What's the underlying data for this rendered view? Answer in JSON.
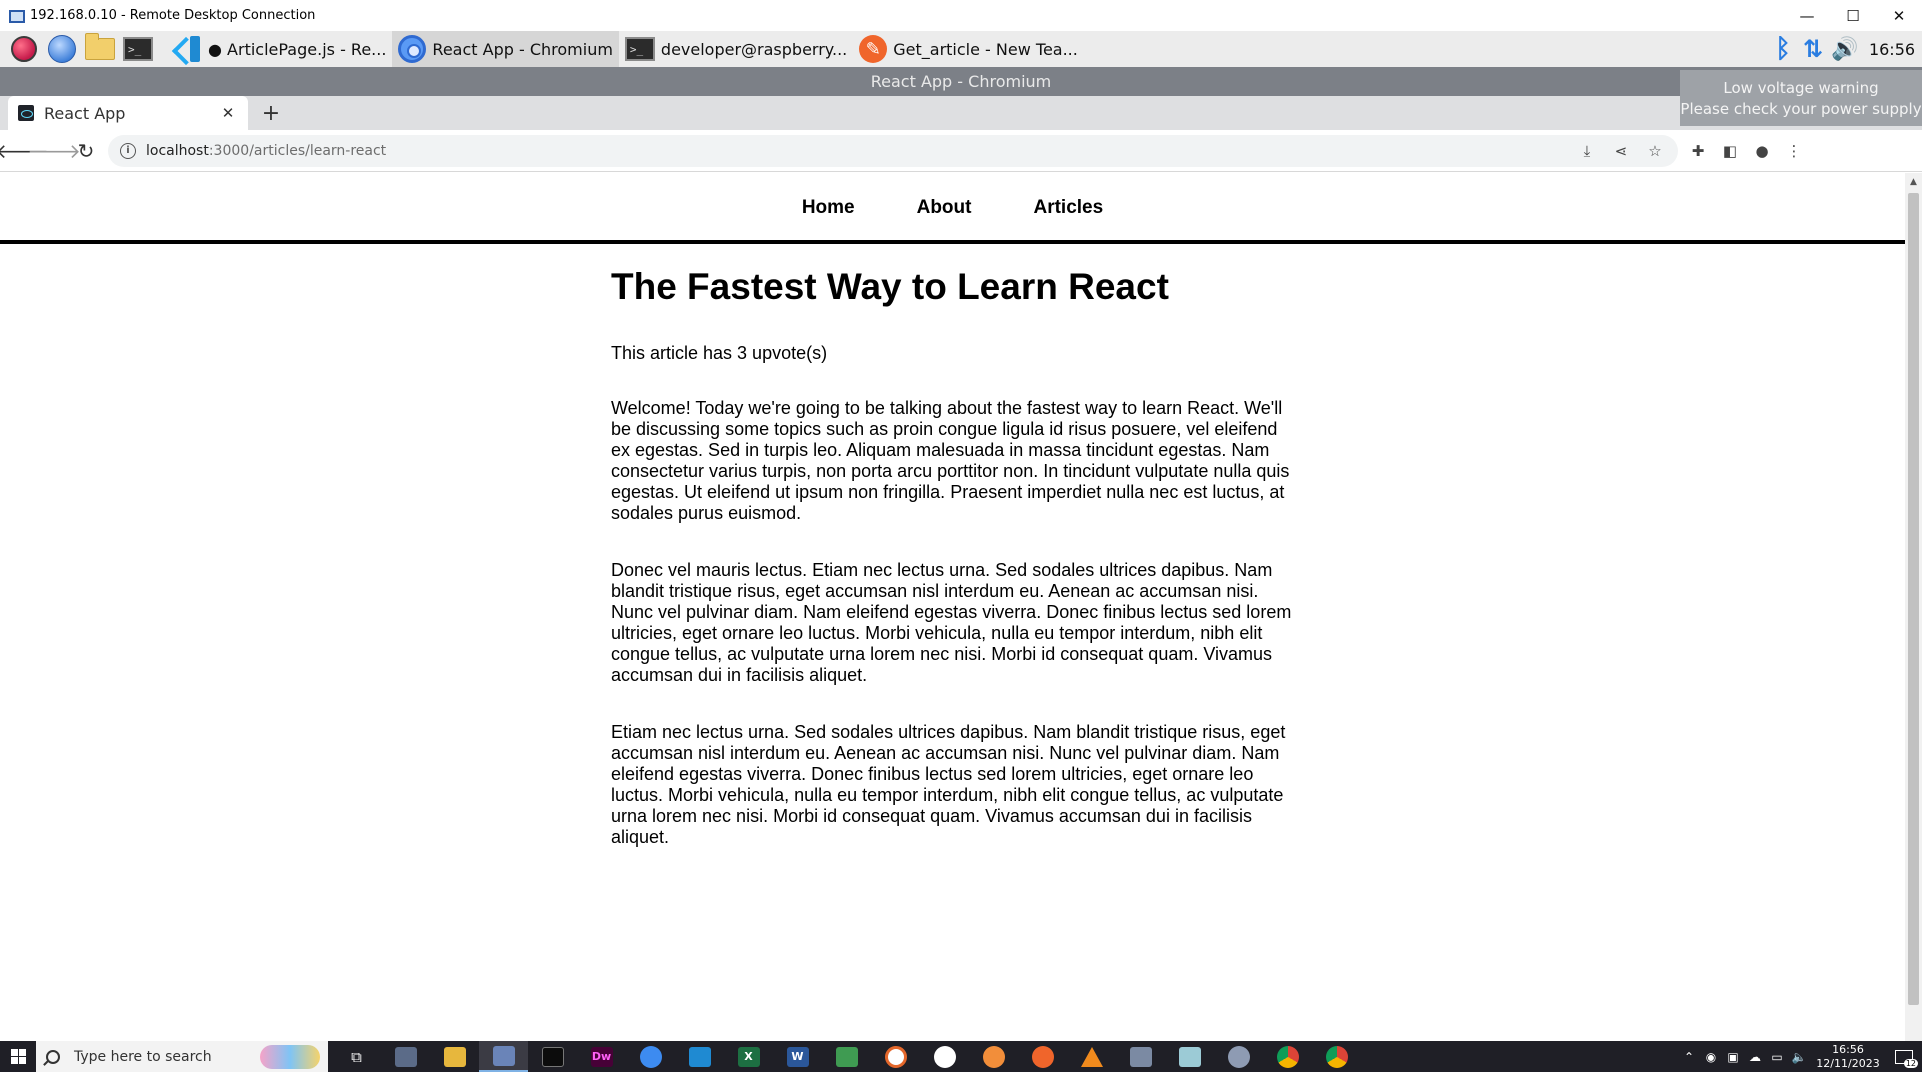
{
  "rdp": {
    "title": "192.168.0.10 - Remote Desktop Connection",
    "minimize": "—",
    "maximize": "☐",
    "close": "✕"
  },
  "pi_panel": {
    "tasks": [
      {
        "label": "● ArticlePage.js - Re..."
      },
      {
        "label": "React App - Chromium"
      },
      {
        "label": "developer@raspberry..."
      },
      {
        "label": "Get_article - New Tea..."
      }
    ],
    "clock": "16:56",
    "terminal_glyph": ">_",
    "geany_glyph": "✎"
  },
  "chromium": {
    "window_title": "React App - Chromium",
    "tab_title": "React App",
    "url_host": "localhost",
    "url_rest": ":3000/articles/learn-react"
  },
  "toast": {
    "line1": "Low voltage warning",
    "line2": "Please check your power supply"
  },
  "site": {
    "nav": [
      {
        "label": "Home"
      },
      {
        "label": "About"
      },
      {
        "label": "Articles"
      }
    ]
  },
  "article": {
    "title": "The Fastest Way to Learn React",
    "upvotes": "This article has 3 upvote(s)",
    "paragraphs": [
      "Welcome! Today we're going to be talking about the fastest way to learn React. We'll be discussing some topics such as proin congue ligula id risus posuere, vel eleifend ex egestas. Sed in turpis leo. Aliquam malesuada in massa tincidunt egestas. Nam consectetur varius turpis, non porta arcu porttitor non. In tincidunt vulputate nulla quis egestas. Ut eleifend ut ipsum non fringilla. Praesent imperdiet nulla nec est luctus, at sodales purus euismod.",
      "Donec vel mauris lectus. Etiam nec lectus urna. Sed sodales ultrices dapibus. Nam blandit tristique risus, eget accumsan nisl interdum eu. Aenean ac accumsan nisi. Nunc vel pulvinar diam. Nam eleifend egestas viverra. Donec finibus lectus sed lorem ultricies, eget ornare leo luctus. Morbi vehicula, nulla eu tempor interdum, nibh elit congue tellus, ac vulputate urna lorem nec nisi. Morbi id consequat quam. Vivamus accumsan dui in facilisis aliquet.",
      "Etiam nec lectus urna. Sed sodales ultrices dapibus. Nam blandit tristique risus, eget accumsan nisl interdum eu. Aenean ac accumsan nisi. Nunc vel pulvinar diam. Nam eleifend egestas viverra. Donec finibus lectus sed lorem ultricies, eget ornare leo luctus. Morbi vehicula, nulla eu tempor interdum, nibh elit congue tellus, ac vulputate urna lorem nec nisi. Morbi id consequat quam. Vivamus accumsan dui in facilisis aliquet."
    ]
  },
  "windows_taskbar": {
    "search_placeholder": "Type here to search",
    "time": "16:56",
    "date": "12/11/2023",
    "notification_count": "12",
    "dreamweaver_label": "Dw",
    "excel_label": "X",
    "word_label": "W"
  }
}
